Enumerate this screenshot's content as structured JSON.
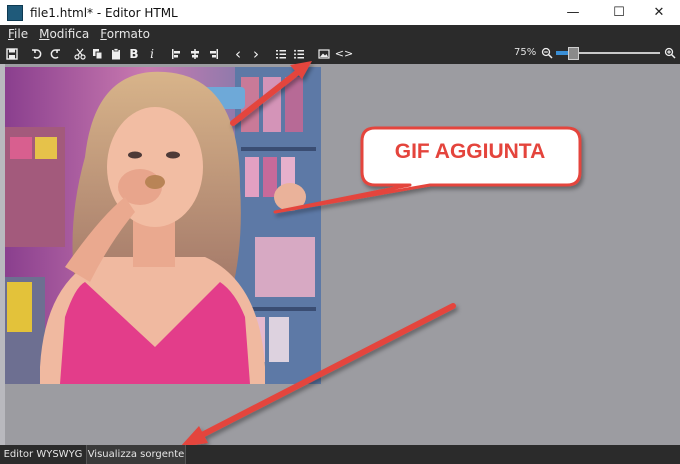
{
  "window": {
    "title": "file1.html* - Editor HTML",
    "minimize_glyph": "—",
    "maximize_glyph": "☐",
    "close_glyph": "✕"
  },
  "menu": [
    {
      "label": "File",
      "accel": "F",
      "rest": "ile"
    },
    {
      "label": "Modifica",
      "accel": "M",
      "rest": "odifica"
    },
    {
      "label": "Formato",
      "accel": "F",
      "rest": "ormato"
    }
  ],
  "toolbar": {
    "icons": [
      "save-icon",
      "undo-icon",
      "redo-icon",
      "cut-icon",
      "copy-icon",
      "paste-icon",
      "bold-icon",
      "italic-icon",
      "align-left-icon",
      "align-center-icon",
      "align-right-icon",
      "outdent-icon",
      "indent-icon",
      "numbered-list-icon",
      "bulleted-list-icon",
      "insert-image-icon",
      "insert-code-icon"
    ],
    "bold_glyph": "B",
    "italic_glyph": "i",
    "outdent_glyph": "‹",
    "indent_glyph": "›",
    "code_glyph": "<>",
    "zoom_label": "75%",
    "zoom_value_percent": 75
  },
  "annotation": {
    "callout_text": "GIF AGGIUNTA",
    "color": "#e4443c"
  },
  "tabs": [
    {
      "label": "Editor WYSWYG"
    },
    {
      "label": "Visualizza sorgente"
    }
  ],
  "colors": {
    "dark_bar": "#2b2b2b",
    "canvas": "#9c9ca1",
    "accent": "#3a8fd6"
  }
}
